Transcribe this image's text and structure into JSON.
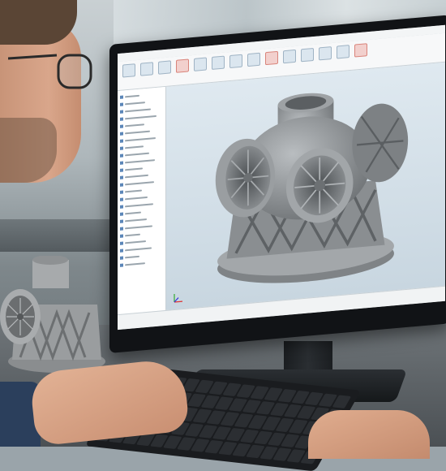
{
  "scene": {
    "description_text": "",
    "monitor": {
      "status_text": "",
      "ribbon_buttons": 14,
      "tree_items": 24
    }
  },
  "colors": {
    "viewport_top": "#dfe9f0",
    "viewport_bottom": "#c8d6e0",
    "part_grey": "#8c9093",
    "bezel": "#111316"
  },
  "icons": [
    "coordinate-axes-icon",
    "ribbon-tool-icon",
    "tree-node-icon"
  ]
}
